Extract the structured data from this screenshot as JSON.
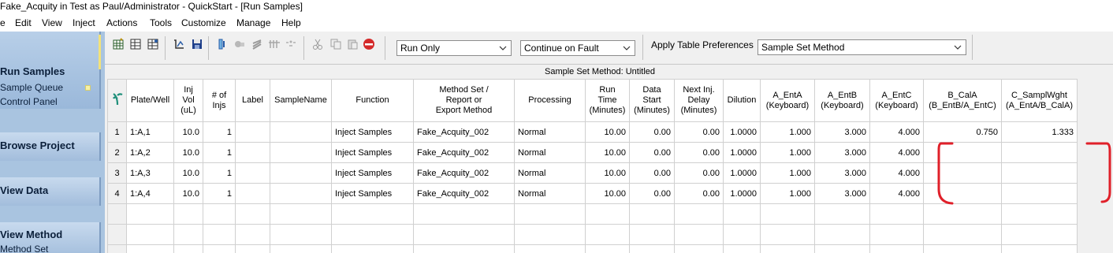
{
  "window": {
    "title": "Fake_Acquity in Test as Paul/Administrator - QuickStart - [Run Samples]"
  },
  "menu": [
    "e",
    "Edit",
    "View",
    "Inject",
    "Actions",
    "Tools",
    "Customize",
    "Manage",
    "Help"
  ],
  "sidebar": {
    "run_samples": {
      "title": "Run Samples",
      "items": [
        "Sample Queue",
        "Control Panel"
      ]
    },
    "browse_project": {
      "title": "Browse Project"
    },
    "view_data": {
      "title": "View Data"
    },
    "view_method": {
      "title": "View Method",
      "sub": "Method Set"
    }
  },
  "toolbar": {
    "run_mode": "Run Only",
    "fault_mode": "Continue on Fault",
    "apply_prefs_label": "Apply Table Preferences",
    "table_pref": "Sample Set Method"
  },
  "grid": {
    "caption": "Sample Set Method: Untitled",
    "columns": [
      [
        "Plate/Well"
      ],
      [
        "Inj",
        "Vol",
        "(uL)"
      ],
      [
        "# of",
        "Injs"
      ],
      [
        "Label"
      ],
      [
        "SampleName"
      ],
      [
        "Function"
      ],
      [
        "Method Set /",
        "Report or",
        "Export Method"
      ],
      [
        "Processing"
      ],
      [
        "Run",
        "Time",
        "(Minutes)"
      ],
      [
        "Data",
        "Start",
        "(Minutes)"
      ],
      [
        "Next Inj.",
        "Delay",
        "(Minutes)"
      ],
      [
        "Dilution"
      ],
      [
        "A_EntA",
        "(Keyboard)"
      ],
      [
        "A_EntB",
        "(Keyboard)"
      ],
      [
        "A_EntC",
        "(Keyboard)"
      ],
      [
        "B_CalA",
        "(B_EntB/A_EntC)"
      ],
      [
        "C_SamplWght",
        "(A_EntA/B_CalA)"
      ]
    ],
    "rows": [
      {
        "n": "1",
        "cells": [
          "1:A,1",
          "10.0",
          "1",
          "",
          "",
          "Inject Samples",
          "Fake_Acquity_002",
          "Normal",
          "10.00",
          "0.00",
          "0.00",
          "1.0000",
          "1.000",
          "3.000",
          "4.000",
          "0.750",
          "1.333"
        ]
      },
      {
        "n": "2",
        "cells": [
          "1:A,2",
          "10.0",
          "1",
          "",
          "",
          "Inject Samples",
          "Fake_Acquity_002",
          "Normal",
          "10.00",
          "0.00",
          "0.00",
          "1.0000",
          "1.000",
          "3.000",
          "4.000",
          "",
          ""
        ]
      },
      {
        "n": "3",
        "cells": [
          "1:A,3",
          "10.0",
          "1",
          "",
          "",
          "Inject Samples",
          "Fake_Acquity_002",
          "Normal",
          "10.00",
          "0.00",
          "0.00",
          "1.0000",
          "1.000",
          "3.000",
          "4.000",
          "",
          ""
        ]
      },
      {
        "n": "4",
        "cells": [
          "1:A,4",
          "10.0",
          "1",
          "",
          "",
          "Inject Samples",
          "Fake_Acquity_002",
          "Normal",
          "10.00",
          "0.00",
          "0.00",
          "1.0000",
          "1.000",
          "3.000",
          "4.000",
          "",
          ""
        ]
      }
    ]
  },
  "colors": {
    "sidebar": "#a9c4e0",
    "annotation": "#e0202a"
  }
}
